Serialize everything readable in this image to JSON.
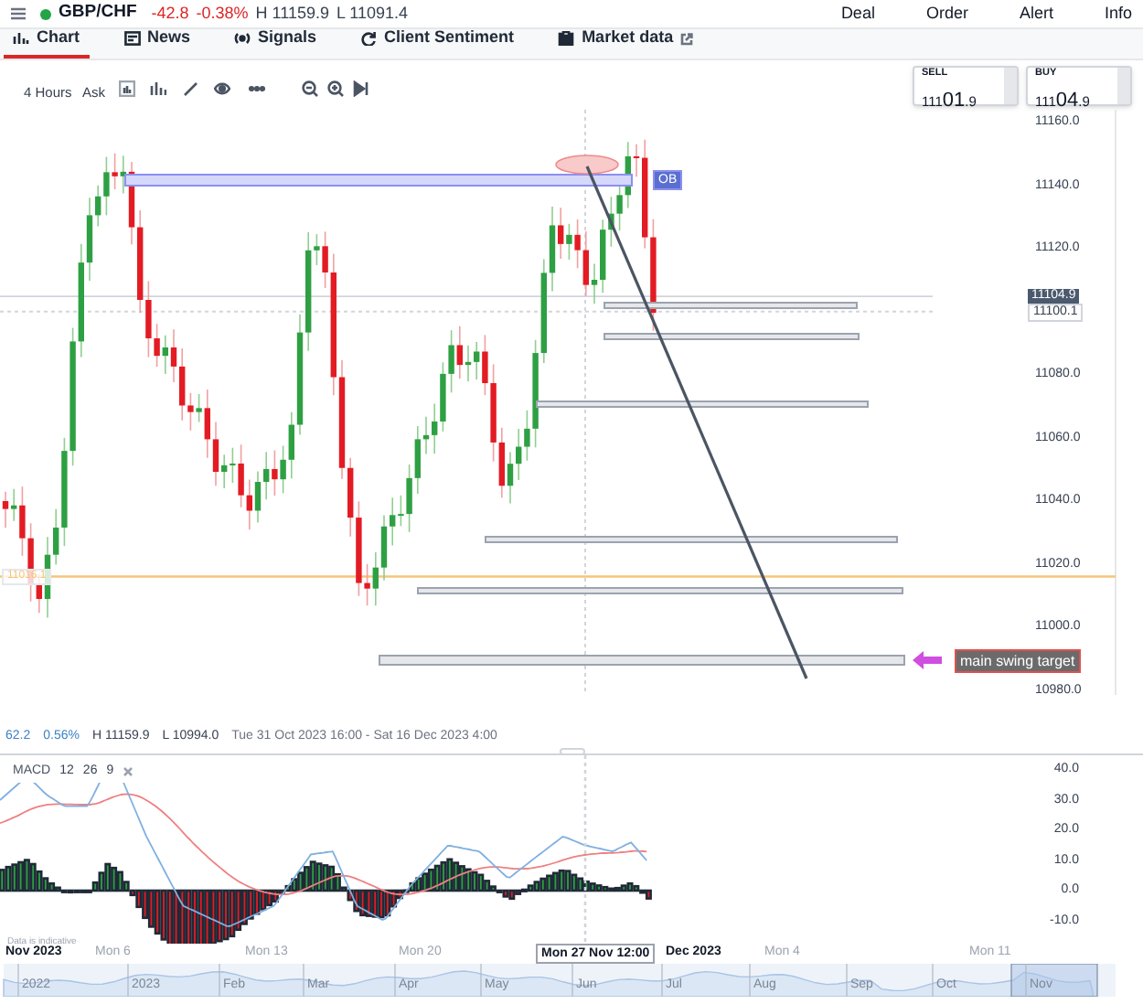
{
  "header": {
    "symbol": "GBP/CHF",
    "change": "-42.8",
    "change_pct": "-0.38%",
    "high": "H 11159.9",
    "low": "L 11091.4",
    "actions": [
      "Deal",
      "Order",
      "Alert",
      "Info"
    ]
  },
  "tabs": [
    {
      "label": "Chart",
      "selected": true,
      "kind": "chart"
    },
    {
      "label": "News",
      "selected": false,
      "kind": "news"
    },
    {
      "label": "Signals",
      "selected": false,
      "kind": "signals"
    },
    {
      "label": "Client Sentiment",
      "selected": false,
      "kind": "sentiment"
    },
    {
      "label": "Market data",
      "selected": false,
      "kind": "external"
    }
  ],
  "toolbar": {
    "interval": "4 Hours",
    "price_type": "Ask"
  },
  "quotes": [
    {
      "label": "SELL",
      "lead": "111",
      "main": "01",
      "tail": ".9"
    },
    {
      "label": "BUY",
      "lead": "111",
      "main": "04",
      "tail": ".9"
    }
  ],
  "price_axis": {
    "ticks": [
      "11160.0",
      "11140.0",
      "11120.0",
      "11080.0",
      "11060.0",
      "11040.0",
      "11020.0",
      "11000.0",
      "10980.0"
    ],
    "current_price": "11104.9",
    "crosshair_price": "11100.1",
    "level_line": "11016.1"
  },
  "annotations": {
    "order_block": "OB",
    "target": "main swing target"
  },
  "info_line": {
    "value": "62.2",
    "percent": "0.56%",
    "high": "H 11159.9",
    "low": "L 10994.0",
    "range": "Tue 31 Oct 2023 16:00 - Sat 16 Dec 2023 4:00"
  },
  "macd": {
    "label": "MACD",
    "params": [
      "12",
      "26",
      "9"
    ],
    "ticks": [
      "40.0",
      "30.0",
      "20.0",
      "10.0",
      "0.0",
      "-10.0"
    ]
  },
  "disclaimer": "Data is indicative",
  "time_axis": [
    {
      "text": "Nov 2023",
      "kind": "month"
    },
    {
      "text": "Mon 6",
      "kind": "day"
    },
    {
      "text": "Mon 13",
      "kind": "day"
    },
    {
      "text": "Mon 20",
      "kind": "day"
    },
    {
      "text": "Mon 27 Nov 12:00",
      "kind": "crosshair"
    },
    {
      "text": "Dec 2023",
      "kind": "month"
    },
    {
      "text": "Mon 4",
      "kind": "day"
    },
    {
      "text": "Mon 11",
      "kind": "day"
    }
  ],
  "navigator": [
    "2022",
    "2023",
    "Feb",
    "Mar",
    "Apr",
    "May",
    "Jun",
    "Jul",
    "Aug",
    "Sep",
    "Oct",
    "Nov"
  ]
}
